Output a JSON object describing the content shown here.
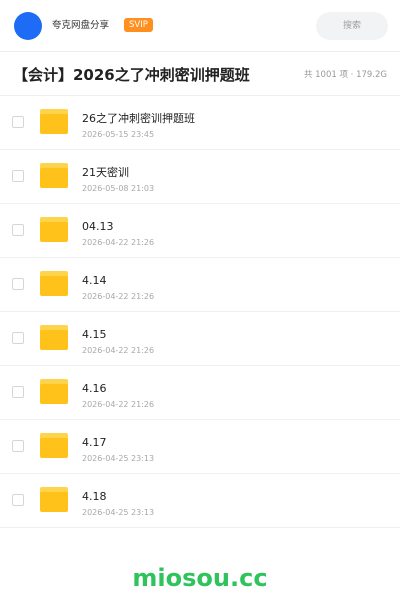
{
  "header": {
    "user_name": "夸克网盘分享",
    "badge": "SVIP",
    "search_placeholder": "搜索",
    "avatar_color": "#1e6cf5",
    "badge_color": "#ff8f1f"
  },
  "share": {
    "title": "【会计】2026之了冲刺密训押题班",
    "summary": "共 1001 项 · 179.2G"
  },
  "files": [
    {
      "name": "26之了冲刺密训押题班",
      "date": "2026-05-15 23:45"
    },
    {
      "name": "21天密训",
      "date": "2026-05-08 21:03"
    },
    {
      "name": "04.13",
      "date": "2026-04-22 21:26"
    },
    {
      "name": "4.14",
      "date": "2026-04-22 21:26"
    },
    {
      "name": "4.15",
      "date": "2026-04-22 21:26"
    },
    {
      "name": "4.16",
      "date": "2026-04-22 21:26"
    },
    {
      "name": "4.17",
      "date": "2026-04-25 23:13"
    },
    {
      "name": "4.18",
      "date": "2026-04-25 23:13"
    }
  ],
  "watermark": "miosou.cc",
  "icons": {
    "folder": "folder-icon",
    "checkbox": "checkbox"
  },
  "colors": {
    "folder_tab": "#ffd44d",
    "folder_body": "#ffc21a",
    "watermark": "#2ec35b"
  }
}
